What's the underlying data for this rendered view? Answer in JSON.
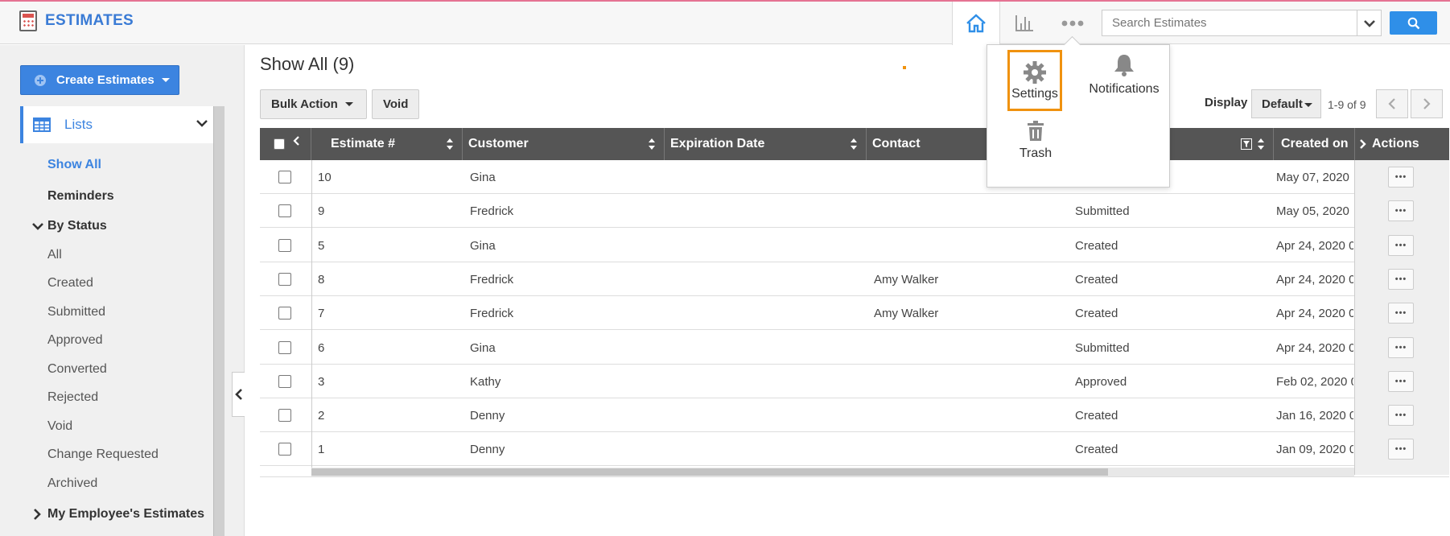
{
  "app": {
    "title": "ESTIMATES"
  },
  "header": {
    "search_placeholder": "Search Estimates",
    "icons": [
      "home-icon",
      "chart-icon",
      "more-icon",
      "chevron-down-icon",
      "search-icon"
    ]
  },
  "sidebar": {
    "create_label": "Create Estimates",
    "lists_label": "Lists",
    "items": {
      "show_all": "Show All",
      "reminders": "Reminders",
      "by_status": "By Status",
      "all": "All",
      "created": "Created",
      "submitted": "Submitted",
      "approved": "Approved",
      "converted": "Converted",
      "rejected": "Rejected",
      "void": "Void",
      "change_requested": "Change Requested",
      "archived": "Archived",
      "my_employees": "My Employee's Estimates"
    }
  },
  "main": {
    "title": "Show All (9)",
    "bulk_action": "Bulk Action",
    "void": "Void",
    "display_label": "Display",
    "display_value": "Default",
    "page_count": "1-9 of 9"
  },
  "table": {
    "headers": {
      "estimate": "Estimate #",
      "customer": "Customer",
      "expiration": "Expiration Date",
      "contact": "Contact",
      "created_on": "Created on",
      "actions": "Actions"
    },
    "rows": [
      {
        "num": "10",
        "customer": "Gina",
        "contact": "",
        "status": "",
        "created": "May 07, 2020"
      },
      {
        "num": "9",
        "customer": "Fredrick",
        "contact": "",
        "status": "Submitted",
        "created": "May 05, 2020"
      },
      {
        "num": "5",
        "customer": "Gina",
        "contact": "",
        "status": "Created",
        "created": "Apr 24, 2020 0"
      },
      {
        "num": "8",
        "customer": "Fredrick",
        "contact": "Amy Walker",
        "status": "Created",
        "created": "Apr 24, 2020 0"
      },
      {
        "num": "7",
        "customer": "Fredrick",
        "contact": "Amy Walker",
        "status": "Created",
        "created": "Apr 24, 2020 0"
      },
      {
        "num": "6",
        "customer": "Gina",
        "contact": "",
        "status": "Submitted",
        "created": "Apr 24, 2020 0"
      },
      {
        "num": "3",
        "customer": "Kathy",
        "contact": "",
        "status": "Approved",
        "created": "Feb 02, 2020 0"
      },
      {
        "num": "2",
        "customer": "Denny",
        "contact": "",
        "status": "Created",
        "created": "Jan 16, 2020 0"
      },
      {
        "num": "1",
        "customer": "Denny",
        "contact": "",
        "status": "Created",
        "created": "Jan 09, 2020 0"
      }
    ],
    "action_glyph": "•••"
  },
  "popup": {
    "settings": "Settings",
    "notifications": "Notifications",
    "trash": "Trash"
  },
  "colors": {
    "accent": "#3c84e0",
    "highlight": "#f0920f",
    "header_row": "#555555"
  }
}
